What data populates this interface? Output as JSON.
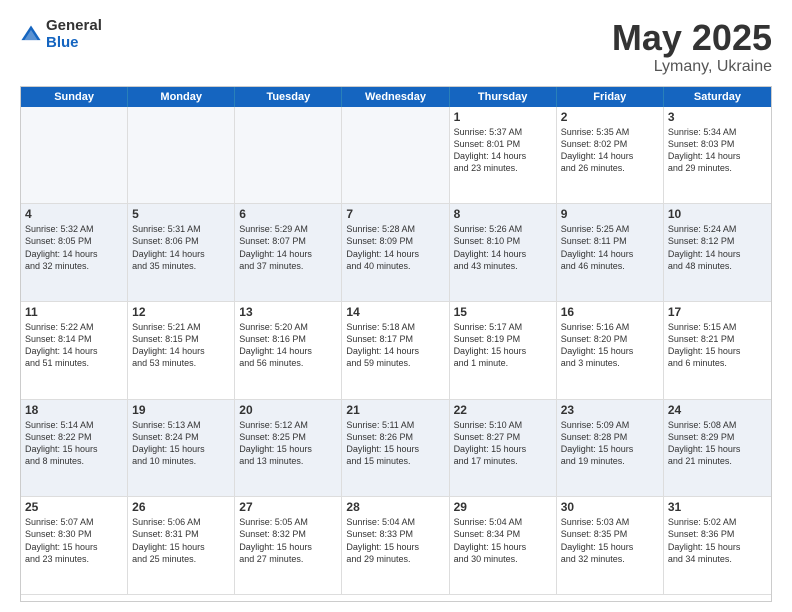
{
  "logo": {
    "general": "General",
    "blue": "Blue"
  },
  "title": {
    "month": "May 2025",
    "location": "Lymany, Ukraine"
  },
  "weekdays": [
    "Sunday",
    "Monday",
    "Tuesday",
    "Wednesday",
    "Thursday",
    "Friday",
    "Saturday"
  ],
  "weeks": [
    [
      {
        "day": "",
        "text": "",
        "empty": true
      },
      {
        "day": "",
        "text": "",
        "empty": true
      },
      {
        "day": "",
        "text": "",
        "empty": true
      },
      {
        "day": "",
        "text": "",
        "empty": true
      },
      {
        "day": "1",
        "text": "Sunrise: 5:37 AM\nSunset: 8:01 PM\nDaylight: 14 hours\nand 23 minutes."
      },
      {
        "day": "2",
        "text": "Sunrise: 5:35 AM\nSunset: 8:02 PM\nDaylight: 14 hours\nand 26 minutes."
      },
      {
        "day": "3",
        "text": "Sunrise: 5:34 AM\nSunset: 8:03 PM\nDaylight: 14 hours\nand 29 minutes."
      }
    ],
    [
      {
        "day": "4",
        "text": "Sunrise: 5:32 AM\nSunset: 8:05 PM\nDaylight: 14 hours\nand 32 minutes."
      },
      {
        "day": "5",
        "text": "Sunrise: 5:31 AM\nSunset: 8:06 PM\nDaylight: 14 hours\nand 35 minutes."
      },
      {
        "day": "6",
        "text": "Sunrise: 5:29 AM\nSunset: 8:07 PM\nDaylight: 14 hours\nand 37 minutes."
      },
      {
        "day": "7",
        "text": "Sunrise: 5:28 AM\nSunset: 8:09 PM\nDaylight: 14 hours\nand 40 minutes."
      },
      {
        "day": "8",
        "text": "Sunrise: 5:26 AM\nSunset: 8:10 PM\nDaylight: 14 hours\nand 43 minutes."
      },
      {
        "day": "9",
        "text": "Sunrise: 5:25 AM\nSunset: 8:11 PM\nDaylight: 14 hours\nand 46 minutes."
      },
      {
        "day": "10",
        "text": "Sunrise: 5:24 AM\nSunset: 8:12 PM\nDaylight: 14 hours\nand 48 minutes."
      }
    ],
    [
      {
        "day": "11",
        "text": "Sunrise: 5:22 AM\nSunset: 8:14 PM\nDaylight: 14 hours\nand 51 minutes."
      },
      {
        "day": "12",
        "text": "Sunrise: 5:21 AM\nSunset: 8:15 PM\nDaylight: 14 hours\nand 53 minutes."
      },
      {
        "day": "13",
        "text": "Sunrise: 5:20 AM\nSunset: 8:16 PM\nDaylight: 14 hours\nand 56 minutes."
      },
      {
        "day": "14",
        "text": "Sunrise: 5:18 AM\nSunset: 8:17 PM\nDaylight: 14 hours\nand 59 minutes."
      },
      {
        "day": "15",
        "text": "Sunrise: 5:17 AM\nSunset: 8:19 PM\nDaylight: 15 hours\nand 1 minute."
      },
      {
        "day": "16",
        "text": "Sunrise: 5:16 AM\nSunset: 8:20 PM\nDaylight: 15 hours\nand 3 minutes."
      },
      {
        "day": "17",
        "text": "Sunrise: 5:15 AM\nSunset: 8:21 PM\nDaylight: 15 hours\nand 6 minutes."
      }
    ],
    [
      {
        "day": "18",
        "text": "Sunrise: 5:14 AM\nSunset: 8:22 PM\nDaylight: 15 hours\nand 8 minutes."
      },
      {
        "day": "19",
        "text": "Sunrise: 5:13 AM\nSunset: 8:24 PM\nDaylight: 15 hours\nand 10 minutes."
      },
      {
        "day": "20",
        "text": "Sunrise: 5:12 AM\nSunset: 8:25 PM\nDaylight: 15 hours\nand 13 minutes."
      },
      {
        "day": "21",
        "text": "Sunrise: 5:11 AM\nSunset: 8:26 PM\nDaylight: 15 hours\nand 15 minutes."
      },
      {
        "day": "22",
        "text": "Sunrise: 5:10 AM\nSunset: 8:27 PM\nDaylight: 15 hours\nand 17 minutes."
      },
      {
        "day": "23",
        "text": "Sunrise: 5:09 AM\nSunset: 8:28 PM\nDaylight: 15 hours\nand 19 minutes."
      },
      {
        "day": "24",
        "text": "Sunrise: 5:08 AM\nSunset: 8:29 PM\nDaylight: 15 hours\nand 21 minutes."
      }
    ],
    [
      {
        "day": "25",
        "text": "Sunrise: 5:07 AM\nSunset: 8:30 PM\nDaylight: 15 hours\nand 23 minutes."
      },
      {
        "day": "26",
        "text": "Sunrise: 5:06 AM\nSunset: 8:31 PM\nDaylight: 15 hours\nand 25 minutes."
      },
      {
        "day": "27",
        "text": "Sunrise: 5:05 AM\nSunset: 8:32 PM\nDaylight: 15 hours\nand 27 minutes."
      },
      {
        "day": "28",
        "text": "Sunrise: 5:04 AM\nSunset: 8:33 PM\nDaylight: 15 hours\nand 29 minutes."
      },
      {
        "day": "29",
        "text": "Sunrise: 5:04 AM\nSunset: 8:34 PM\nDaylight: 15 hours\nand 30 minutes."
      },
      {
        "day": "30",
        "text": "Sunrise: 5:03 AM\nSunset: 8:35 PM\nDaylight: 15 hours\nand 32 minutes."
      },
      {
        "day": "31",
        "text": "Sunrise: 5:02 AM\nSunset: 8:36 PM\nDaylight: 15 hours\nand 34 minutes."
      }
    ]
  ],
  "row_bg": [
    "#ffffff",
    "#edf1f7",
    "#ffffff",
    "#edf1f7",
    "#ffffff"
  ]
}
